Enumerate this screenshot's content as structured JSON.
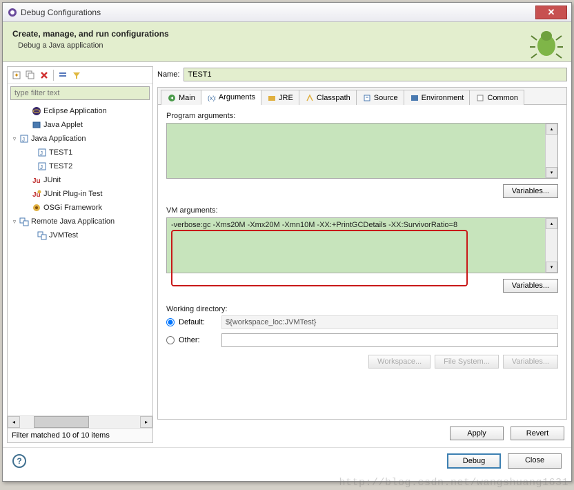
{
  "window": {
    "title": "Debug Configurations"
  },
  "header": {
    "title": "Create, manage, and run configurations",
    "subtitle": "Debug a Java application"
  },
  "filter": {
    "placeholder": "type filter text",
    "status": "Filter matched 10 of 10 items"
  },
  "tree": {
    "items": [
      {
        "label": "Eclipse Application",
        "icon": "eclipse"
      },
      {
        "label": "Java Applet",
        "icon": "applet"
      },
      {
        "label": "Java Application",
        "icon": "java-app",
        "expanded": true,
        "children": [
          {
            "label": "TEST1",
            "icon": "run",
            "selected": true
          },
          {
            "label": "TEST2",
            "icon": "run"
          }
        ]
      },
      {
        "label": "JUnit",
        "icon": "junit"
      },
      {
        "label": "JUnit Plug-in Test",
        "icon": "junit-plugin"
      },
      {
        "label": "OSGi Framework",
        "icon": "osgi"
      },
      {
        "label": "Remote Java Application",
        "icon": "remote",
        "expanded": true,
        "children": [
          {
            "label": "JVMTest",
            "icon": "run"
          }
        ]
      }
    ]
  },
  "form": {
    "name_label": "Name:",
    "name_value": "TEST1"
  },
  "tabs": {
    "items": [
      {
        "label": "Main",
        "icon": "main"
      },
      {
        "label": "Arguments",
        "icon": "args",
        "active": true
      },
      {
        "label": "JRE",
        "icon": "jre"
      },
      {
        "label": "Classpath",
        "icon": "classpath"
      },
      {
        "label": "Source",
        "icon": "source"
      },
      {
        "label": "Environment",
        "icon": "env"
      },
      {
        "label": "Common",
        "icon": "common"
      }
    ]
  },
  "args": {
    "program_label": "Program arguments:",
    "program_value": "",
    "vm_label": "VM arguments:",
    "vm_value": "-verbose:gc -Xms20M -Xmx20M -Xmn10M -XX:+PrintGCDetails -XX:SurvivorRatio=8",
    "variables_btn": "Variables..."
  },
  "wd": {
    "title": "Working directory:",
    "default_label": "Default:",
    "default_value": "${workspace_loc:JVMTest}",
    "other_label": "Other:",
    "other_value": "",
    "workspace_btn": "Workspace...",
    "filesystem_btn": "File System...",
    "variables_btn": "Variables..."
  },
  "buttons": {
    "apply": "Apply",
    "revert": "Revert",
    "debug": "Debug",
    "close": "Close"
  },
  "watermark": "http://blog.csdn.net/wangshuang1631"
}
